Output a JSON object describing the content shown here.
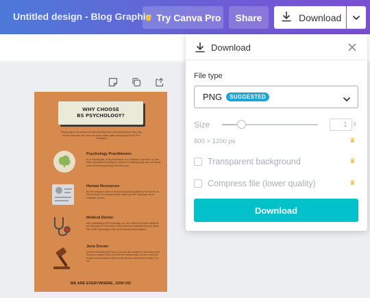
{
  "header": {
    "doc_title": "Untitled design - Blog Graphic",
    "pro_label": "Try Canva Pro",
    "share_label": "Share",
    "download_label": "Download"
  },
  "infographic": {
    "title_line1": "WHY CHOOSE",
    "title_line2": "BS PSYCHOLOGY?",
    "intro": "Psychology is the science of understanding one's mind and behavior, they say, but it's more than that. Here are some career paths and options for BS PSY Graduates",
    "items": [
      {
        "title": "Psychology Practitioners",
        "text": "As a Psychologist, a Psychometrician or a Guidance Counselor! You can either specialize at focusing on research or helping people who are having a hard time through therapy. Be their hope."
      },
      {
        "title": "Human Resources",
        "text": "Be the company's savior in terms of accepting applicants! You can be an HR personnel in a company which makes you the \"employee-not-so-employee\" person."
      },
      {
        "title": "Medical Doctor",
        "text": "After graduating in BS Psychology, you can continue to pursue Medicine and specialize in Psychiatry or any medical specialization that you desire. Part of BS Psychology's units are for Medical Intermediates!"
      },
      {
        "title": "Juris Doctor",
        "text": "Seek the Debating Med School, you can also continue in Law School and become a Lawyer which you have the fundamentals on how to read and resolve human behavior which could help your case where at least 10 or not."
      }
    ],
    "footer": "WE ARE EVERYWHERE, JOIN US!"
  },
  "download_panel": {
    "title": "Download",
    "file_type_label": "File type",
    "file_type_value": "PNG",
    "suggested_badge": "SUGGESTED",
    "size_label": "Size",
    "size_value": "1",
    "size_suffix": "x",
    "dimensions": "800 × 1200 px",
    "transparent_label": "Transparent background",
    "compress_label": "Compress file (lower quality)",
    "download_button": "Download"
  },
  "colors": {
    "accent_teal": "#02c1cb",
    "badge_blue": "#1fa4d8",
    "pro_crown": "#f7c534",
    "page_bg": "#d68a4d"
  },
  "icons": [
    "crown-icon",
    "download-icon",
    "chevron-down-icon",
    "close-icon",
    "note-icon",
    "duplicate-icon",
    "share-add-icon",
    "brain-icon",
    "profile-icon",
    "stethoscope-icon",
    "gavel-icon"
  ]
}
